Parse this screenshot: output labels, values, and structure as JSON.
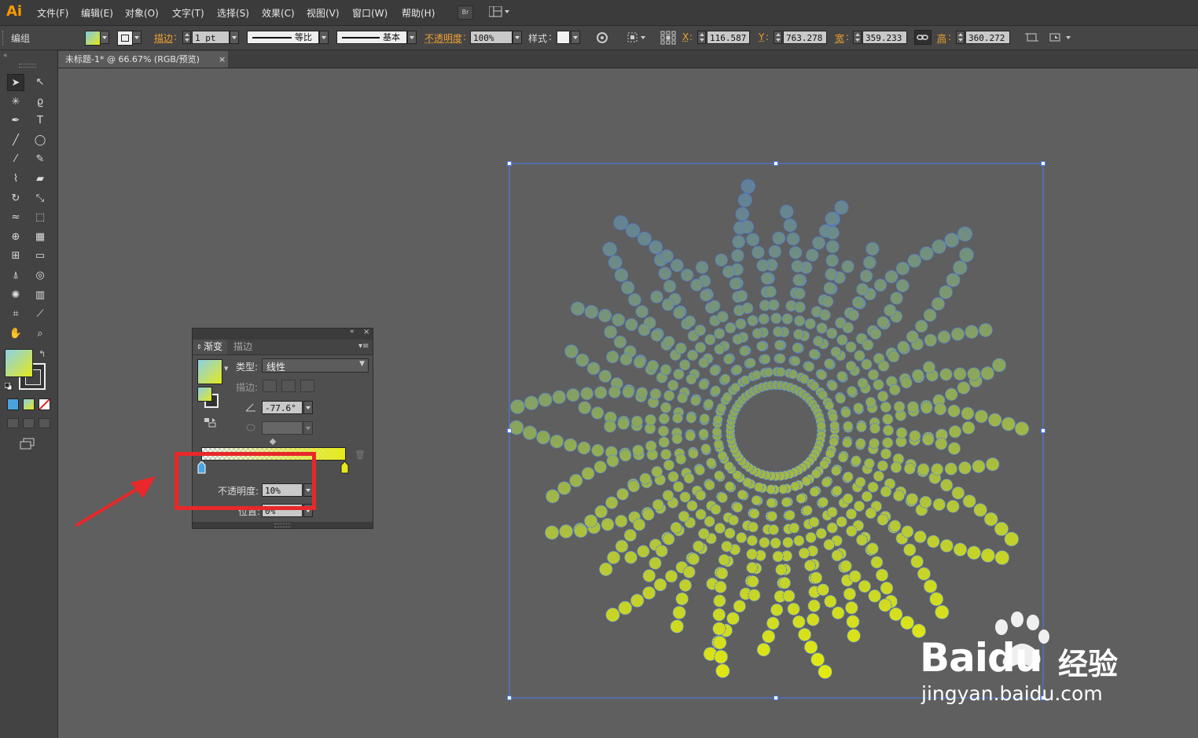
{
  "app": {
    "logo": "Ai"
  },
  "menu": [
    "文件(F)",
    "编辑(E)",
    "对象(O)",
    "文字(T)",
    "选择(S)",
    "效果(C)",
    "视图(V)",
    "窗口(W)",
    "帮助(H)"
  ],
  "menu_buttons": {
    "bridge": "Br"
  },
  "control_bar": {
    "selection_label": "编组",
    "stroke_label": "描边",
    "stroke_weight": "1 pt",
    "profile": "等比",
    "brush": "基本",
    "opacity_label": "不透明度",
    "opacity_value": "100%",
    "style_label": "样式",
    "x_label": "X",
    "x_value": "116.587",
    "y_label": "Y",
    "y_value": "763.278",
    "w_label": "宽",
    "w_value": "359.233",
    "h_label": "高",
    "h_value": "360.272"
  },
  "document_tab": {
    "title": "未标题-1* @ 66.67% (RGB/预览)",
    "close": "×"
  },
  "tools": [
    "selection-tool",
    "direct-selection-tool",
    "magic-wand-tool",
    "lasso-tool",
    "pen-tool",
    "type-tool",
    "line-tool",
    "ellipse-tool",
    "paintbrush-tool",
    "pencil-tool",
    "blob-brush-tool",
    "eraser-tool",
    "rotate-tool",
    "scale-tool",
    "warp-tool",
    "free-transform-tool",
    "shape-builder-tool",
    "perspective-grid-tool",
    "mesh-tool",
    "gradient-tool",
    "eyedropper-tool",
    "blend-tool",
    "symbol-sprayer-tool",
    "column-graph-tool",
    "artboard-tool",
    "slice-tool",
    "hand-tool",
    "zoom-tool"
  ],
  "gradient_panel": {
    "tab_gradient": "渐变",
    "tab_stroke": "描边",
    "type_label": "类型:",
    "type_value": "线性",
    "stroke_label": "描边:",
    "angle_value": "-77.6°",
    "opacity_label": "不透明度:",
    "opacity_value": "10%",
    "location_label": "位置:",
    "location_value": "0%"
  },
  "colors": {
    "gradient_start": "#7ec8e3",
    "gradient_end": "#e6ea1c",
    "selection_blue": "#4a7cf0",
    "annotation_red": "#e8282b",
    "ai_orange": "#ff9a00"
  },
  "watermark": {
    "brand": "Baidu",
    "brand_cn": "经验",
    "url": "jingyan.baidu.com"
  }
}
